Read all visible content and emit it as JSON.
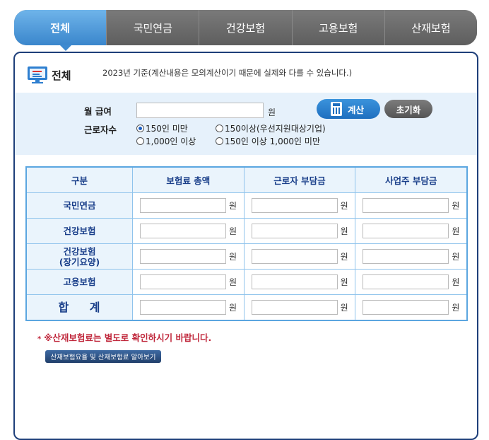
{
  "tabs": [
    {
      "label": "전체",
      "active": true
    },
    {
      "label": "국민연금",
      "active": false
    },
    {
      "label": "건강보험",
      "active": false
    },
    {
      "label": "고용보험",
      "active": false
    },
    {
      "label": "산재보험",
      "active": false
    }
  ],
  "header": {
    "title": "전체",
    "note": "2023년 기준(계산내용은 모의계산이기 때문에 실제와 다를 수 있습니다.)"
  },
  "form": {
    "wage_label": "월 급여",
    "wage_value": "",
    "unit": "원",
    "calc_label": "계산",
    "reset_label": "초기화",
    "workers_label": "근로자수",
    "options": [
      {
        "label": "150인 미만",
        "selected": true
      },
      {
        "label": "150이상(우선지원대상기업)",
        "selected": false
      },
      {
        "label": "1,000인 이상",
        "selected": false
      },
      {
        "label": "150인 이상 1,000인 미만",
        "selected": false
      }
    ]
  },
  "table": {
    "headers": [
      "구분",
      "보험료 총액",
      "근로자 부담금",
      "사업주 부담금"
    ],
    "rows": [
      {
        "label": "국민연금"
      },
      {
        "label": "건강보험"
      },
      {
        "label": "건강보험",
        "sub": "(장기요양)"
      },
      {
        "label": "고용보험"
      },
      {
        "label": "합  계"
      }
    ],
    "unit": "원"
  },
  "notice": "※산재보험료는 별도로 확인하시기 바랍니다.",
  "notice_bullet": "*",
  "link_label": "산재보험요율 및 산재보험료 알아보기",
  "colors": {
    "active_tab": "#3a86cc",
    "panel_border": "#1e3f7a",
    "warning": "#c0283c"
  }
}
